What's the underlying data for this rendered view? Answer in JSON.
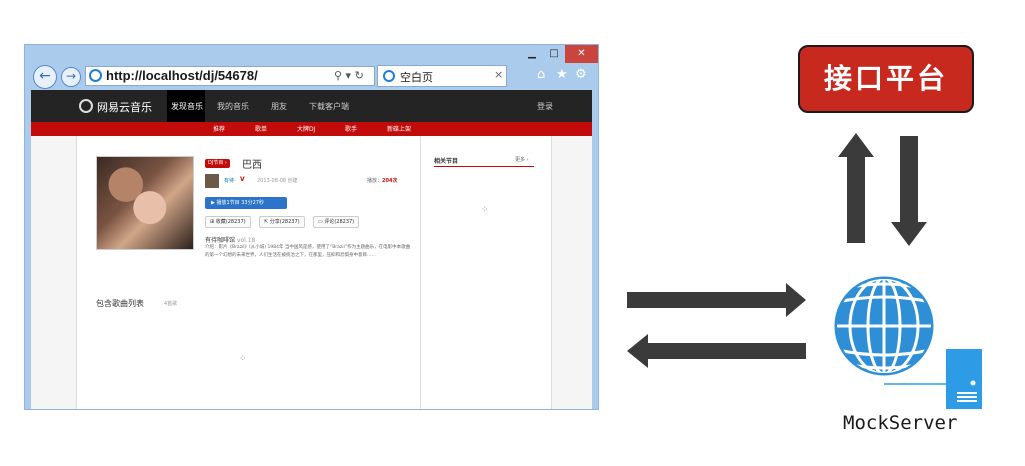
{
  "browser": {
    "address": "http://localhost/dj/54678/",
    "address_tools": "⚲ ▾ ↻",
    "tab_label": "空白页",
    "tab_close": "×",
    "window_min": "▁",
    "window_max": "□",
    "window_close": "✕"
  },
  "site": {
    "logo": "网易云音乐",
    "nav": [
      "发现音乐",
      "我的音乐",
      "朋友",
      "下载客户端"
    ],
    "login": "登录",
    "subnav": [
      "推荐",
      "歌单",
      "大牌DJ",
      "歌手",
      "新碟上架"
    ]
  },
  "program": {
    "tag": "DJ节目 ›",
    "title": "巴西",
    "author": "有待",
    "vip": "V",
    "created": "2013-08-08 创建",
    "plays_label": "播放：",
    "plays_value": "204次",
    "play_button": "播放1节目  33分27秒",
    "actions": [
      "收藏(28237)",
      "分享(28237)",
      "评论(28237)"
    ],
    "name": "有待咖啡馆",
    "episode": "vol.18",
    "intro": "介绍：影片《Brazil》(从小城) 1984年 当中国风是感，使用了“Brazil”作为主题曲乐，在电影中本歌曲的第一个幻想的未来世界，人们生活在被统治之下，在那里，压抑和恐惧身中意目……",
    "songs_title": "包含歌曲列表",
    "songs_count": "4首歌"
  },
  "sidebar": {
    "title": "相关节目",
    "more": "更多 ›"
  },
  "diagram": {
    "platform_label": "接口平台",
    "server_label": "MockServer",
    "colors": {
      "platform_fill": "#c8291e",
      "arrow": "#3b3b3b",
      "globe": "#2e8fd6",
      "server": "#2e9be6"
    },
    "icons": [
      "globe-icon",
      "server-icon"
    ]
  }
}
